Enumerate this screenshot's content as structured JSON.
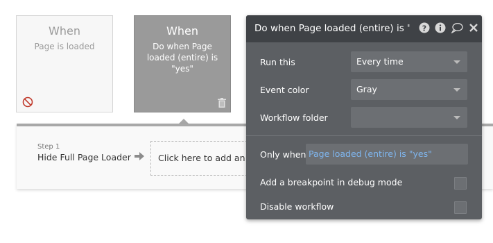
{
  "cards": [
    {
      "when": "When",
      "desc": "Page is loaded"
    },
    {
      "when": "When",
      "desc": "Do when Page loaded (entire) is \"yes\""
    }
  ],
  "steps": {
    "step1": {
      "number": "Step 1",
      "title": "Hide Full Page Loader"
    },
    "add_action": "Click here to add an action..."
  },
  "panel": {
    "title": "Do when Page loaded (entire) is \"yes\"",
    "header_icons": [
      "help-icon",
      "info-icon",
      "comment-icon",
      "close-icon"
    ],
    "run_this": {
      "label": "Run this",
      "value": "Every time"
    },
    "event_color": {
      "label": "Event color",
      "value": "Gray"
    },
    "workflow_folder": {
      "label": "Workflow folder",
      "value": ""
    },
    "only_when": {
      "label": "Only when",
      "value": "Page loaded (entire) is \"yes\""
    },
    "breakpoint": {
      "label": "Add a breakpoint in debug mode",
      "checked": false
    },
    "disable": {
      "label": "Disable workflow",
      "checked": false
    }
  },
  "colors": {
    "panel_bg": "#5c5f63",
    "panel_header": "#3f4246",
    "condition_text": "#7fb6ef",
    "selected_card": "#9a9a9a",
    "disabled_icon": "#c0392b"
  }
}
